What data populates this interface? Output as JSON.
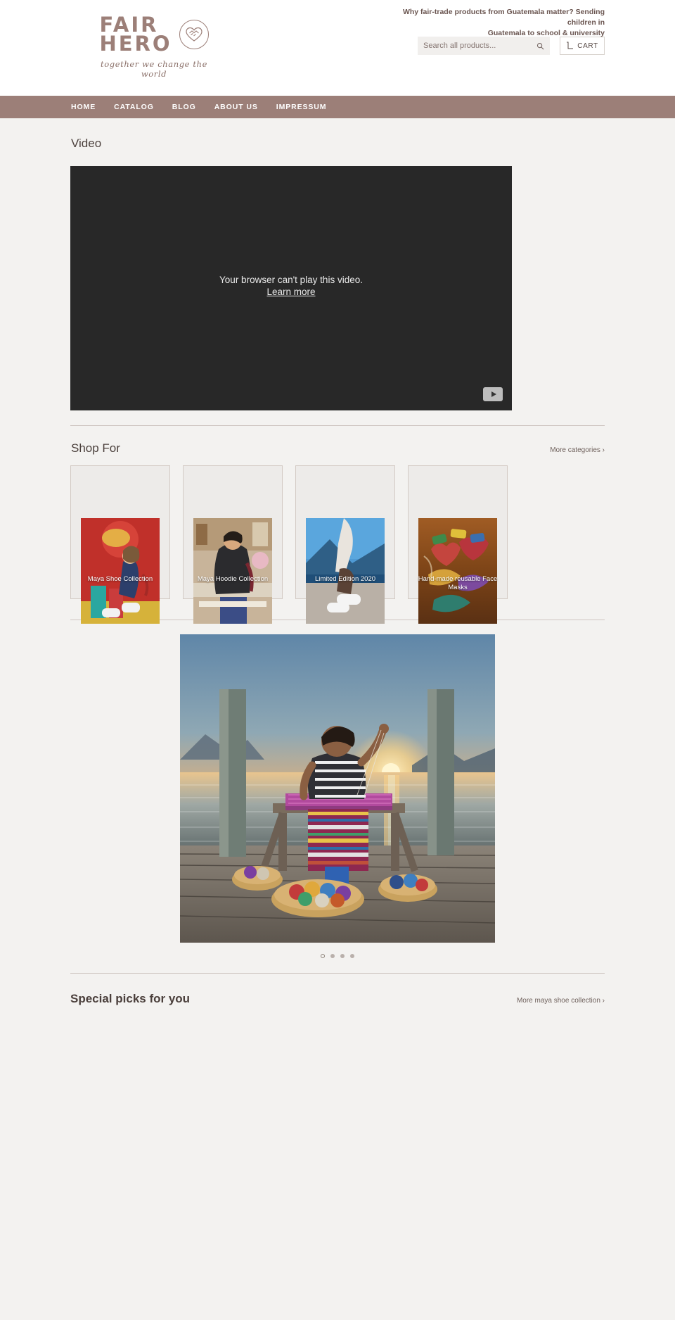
{
  "brand": {
    "line1": "FAIR",
    "line2": "HERO",
    "tagline": "together we change the world",
    "mark_icon": "handshake-heart-icon"
  },
  "header": {
    "promo_line1": "Why fair-trade products from Guatemala matter? Sending children in",
    "promo_line2": "Guatemala to school & university",
    "search": {
      "placeholder": "Search all products...",
      "value": "",
      "icon": "search-icon"
    },
    "cart": {
      "label": "CART",
      "icon": "cart-icon"
    }
  },
  "nav": {
    "items": [
      {
        "label": "HOME"
      },
      {
        "label": "CATALOG"
      },
      {
        "label": "BLOG"
      },
      {
        "label": "ABOUT US"
      },
      {
        "label": "IMPRESSUM"
      }
    ]
  },
  "video_section": {
    "title": "Video",
    "message": "Your browser can't play this video.",
    "learn_more": "Learn more",
    "play_icon": "play-icon"
  },
  "shop_for": {
    "title": "Shop For",
    "more_label": "More categories ›",
    "categories": [
      {
        "label": "Maya Shoe Collection"
      },
      {
        "label": "Maya Hoodie Collection"
      },
      {
        "label": "Limited Edition 2020"
      },
      {
        "label": "Hand-made reusable Face Masks"
      }
    ]
  },
  "carousel": {
    "slides": 4,
    "active": 0
  },
  "special_picks": {
    "title": "Special picks for you",
    "more_label": "More maya shoe collection ›"
  },
  "colors": {
    "brand": "#9c7f78",
    "page_bg": "#f3f2f0",
    "video_bg": "#282828",
    "card_border": "#d3cac4"
  }
}
